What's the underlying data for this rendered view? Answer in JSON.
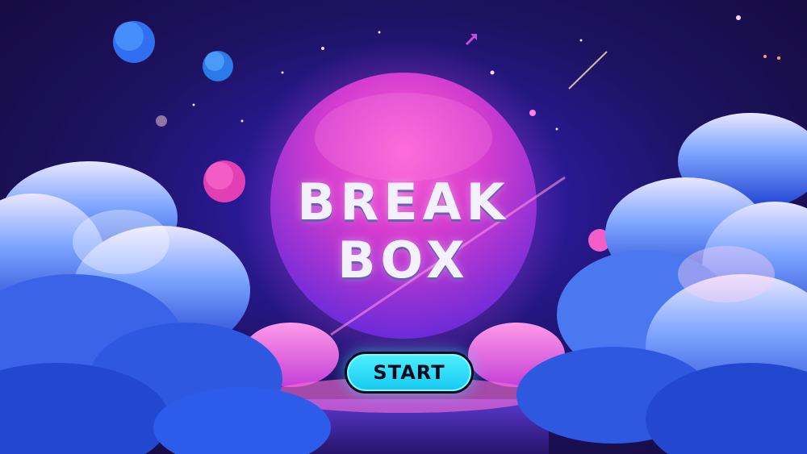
{
  "game": {
    "title_line1": "BREAK",
    "title_line2": "BOX",
    "start_label": "START"
  },
  "colors": {
    "planet": "#d13bd0",
    "button": "#2fdcf8",
    "sky": "#2a1a9a",
    "clouds": "#3f7ef0"
  },
  "icons": {
    "arrow": "arrow-up-right-icon"
  }
}
